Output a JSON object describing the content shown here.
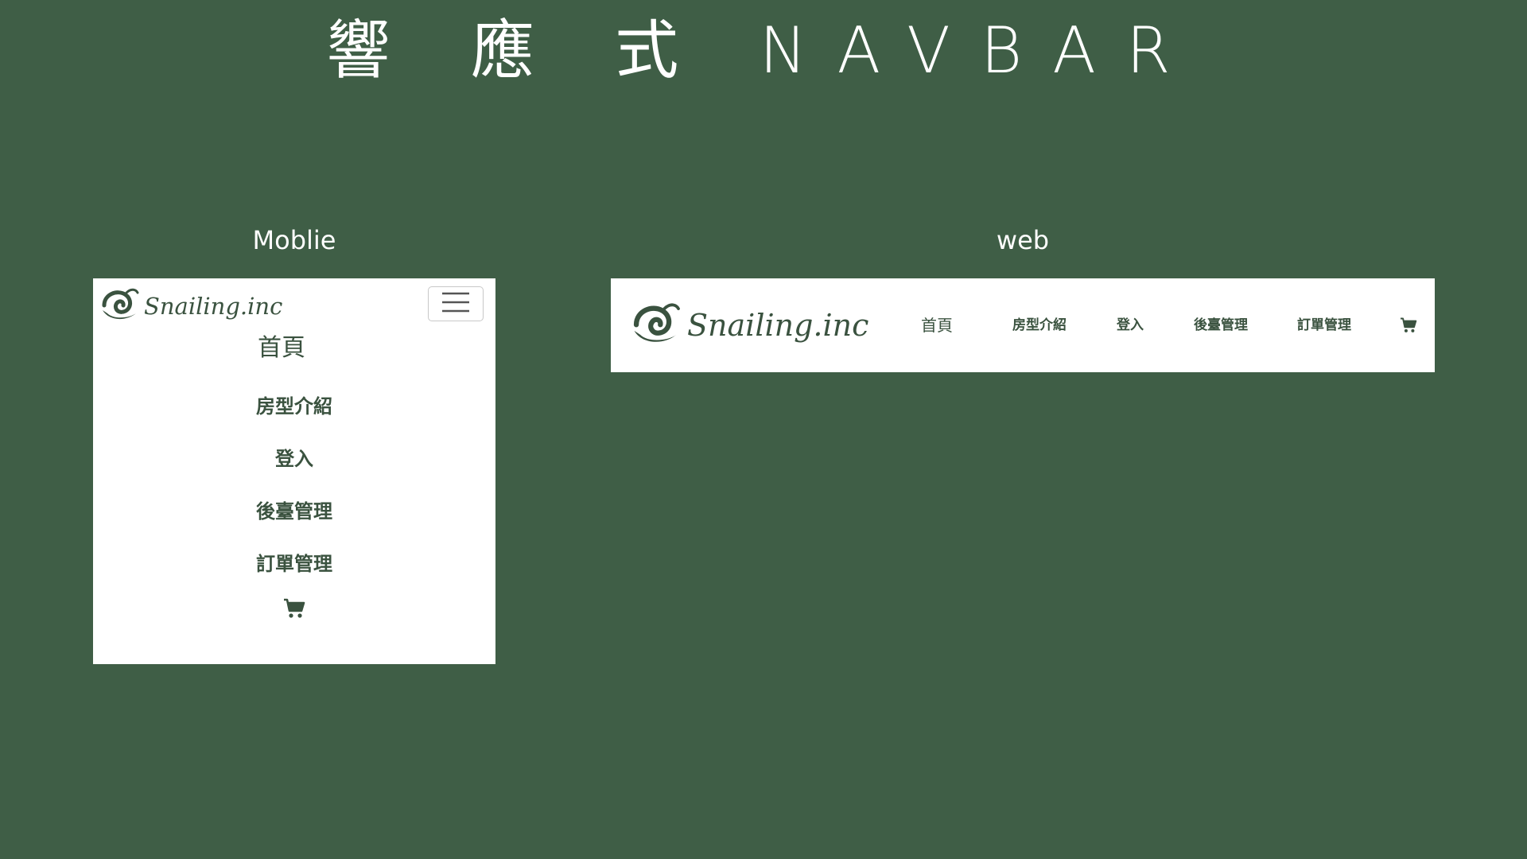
{
  "page": {
    "title": "響 應 式 NAVBAR",
    "background_color": "#3f5e46",
    "accent_color": "#3a523f"
  },
  "mobile": {
    "section_label": "Moblie",
    "brand": "Snailing.inc",
    "logo_icon": "snail-shell-icon",
    "toggler_icon": "hamburger-menu-icon",
    "nav_items": [
      "首頁",
      "房型介紹",
      "登入",
      "後臺管理",
      "訂單管理"
    ],
    "cart_icon": "shopping-cart-icon"
  },
  "web": {
    "section_label": "web",
    "brand": "Snailing.inc",
    "logo_icon": "snail-shell-icon",
    "nav_items": [
      "首頁",
      "房型介紹",
      "登入",
      "後臺管理",
      "訂單管理"
    ],
    "cart_icon": "shopping-cart-icon"
  }
}
